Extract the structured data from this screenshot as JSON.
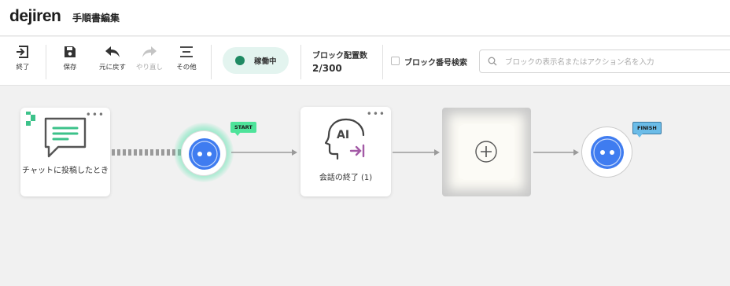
{
  "header": {
    "logo": "dejiren",
    "page_title": "手順書編集"
  },
  "toolbar": {
    "exit_label": "終了",
    "save_label": "保存",
    "undo_label": "元に戻す",
    "redo_label": "やり直し",
    "more_label": "その他",
    "status_label": "稼働中",
    "status_color": "#1f8a63",
    "block_count_label": "ブロック配置数",
    "block_count_value": "2/300",
    "block_number_search_label": "ブロック番号検索",
    "search_placeholder": "ブロックの表示名またはアクション名を入力",
    "search_value": ""
  },
  "flow": {
    "trigger_label": "チャットに投稿したとき",
    "start_badge": "START",
    "start_badge_color": "#4ee39a",
    "ai_block_label": "会話の終了 (1)",
    "ai_icon_text": "AI",
    "finish_badge": "FINISH",
    "finish_badge_color": "#6bbce8",
    "node_color": "#3f7cf0",
    "trigger_icon_color": "#3cc28a",
    "ai_arrow_color": "#a35aa6"
  }
}
